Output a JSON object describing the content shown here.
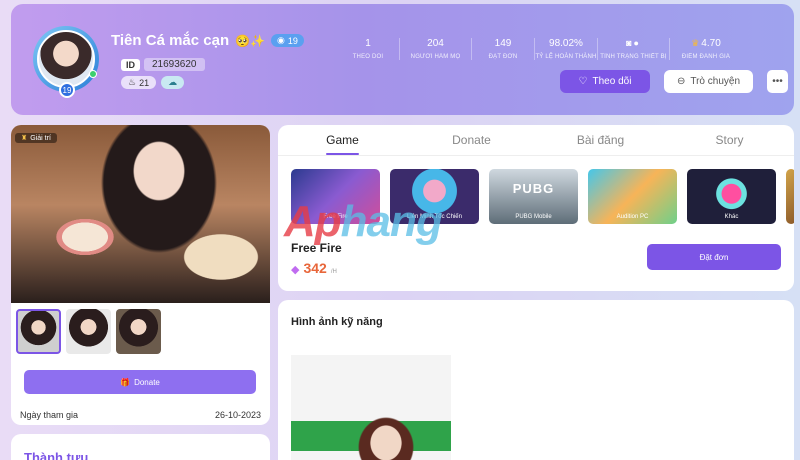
{
  "profile": {
    "name": "Tiên Cá mắc cạn",
    "name_emoji": "🥺✨",
    "level": "19",
    "avatar_level": "19",
    "id_label": "ID",
    "id_value": "21693620",
    "badge_count": "21",
    "badge_icon": "cloud-icon"
  },
  "stats": [
    {
      "value": "1",
      "label": "THEO DÕI"
    },
    {
      "value": "204",
      "label": "NGƯỜI HÂM MỘ"
    },
    {
      "value": "149",
      "label": "ĐẶT ĐƠN"
    },
    {
      "value": "98.02%",
      "label": "TỶ LỆ HOÀN THÀNH"
    },
    {
      "value": "",
      "label": "TÌNH TRẠNG THIẾT BỊ"
    },
    {
      "value": "4.70",
      "label": "ĐIỂM ĐÁNH GIÁ"
    }
  ],
  "actions": {
    "follow_label": "Theo dõi",
    "chat_label": "Trò chuyện",
    "more_label": "•••"
  },
  "left": {
    "category_tag": "Giải trí",
    "donate_label": "Donate",
    "join_label": "Ngày tham gia",
    "join_date": "26-10-2023",
    "achievements_title": "Thành tựu"
  },
  "tabs": [
    {
      "label": "Game",
      "active": true
    },
    {
      "label": "Donate",
      "active": false
    },
    {
      "label": "Bài đăng",
      "active": false
    },
    {
      "label": "Story",
      "active": false
    }
  ],
  "games": [
    {
      "name": "Free Fire"
    },
    {
      "name": "Liên Minh Tốc Chiến"
    },
    {
      "name": "PUBG Mobile",
      "art_text": "PUBG"
    },
    {
      "name": "Audition PC"
    },
    {
      "name": "Khác"
    }
  ],
  "selected_game": {
    "name": "Free Fire",
    "price": "342",
    "unit": "/H",
    "order_label": "Đặt đơn"
  },
  "skills": {
    "title": "Hình ảnh kỹ năng"
  },
  "watermark": {
    "text_a": "Ap",
    "text_b": "hang"
  },
  "colors": {
    "accent": "#7c55e6",
    "price": "#e8663a",
    "online": "#3ccf6e"
  }
}
